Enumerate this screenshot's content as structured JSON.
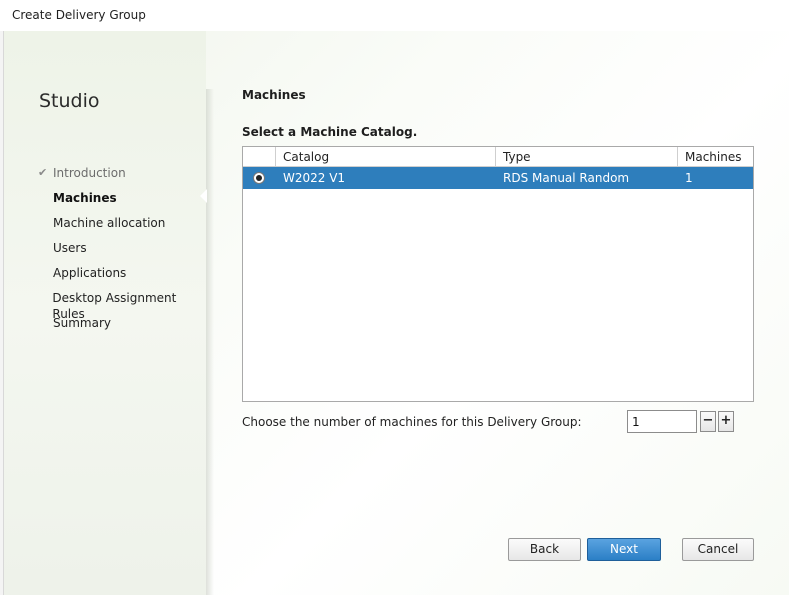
{
  "window": {
    "title": "Create Delivery Group"
  },
  "sidebar": {
    "title": "Studio",
    "steps": [
      {
        "label": "Introduction",
        "state": "done"
      },
      {
        "label": "Machines",
        "state": "active"
      },
      {
        "label": "Machine allocation",
        "state": "pending"
      },
      {
        "label": "Users",
        "state": "pending"
      },
      {
        "label": "Applications",
        "state": "pending"
      },
      {
        "label": "Desktop Assignment Rules",
        "state": "pending"
      },
      {
        "label": "Summary",
        "state": "pending"
      }
    ]
  },
  "main": {
    "title": "Machines",
    "catalog_prompt": "Select a Machine Catalog.",
    "table": {
      "columns": [
        "Catalog",
        "Type",
        "Machines"
      ],
      "rows": [
        {
          "catalog": "W2022 V1",
          "type": "RDS Manual Random",
          "machines": "1",
          "selected": true
        }
      ]
    },
    "count_label": "Choose the number of machines for this Delivery Group:",
    "count_value": "1",
    "minus_label": "−",
    "plus_label": "+"
  },
  "buttons": {
    "back": "Back",
    "next": "Next",
    "cancel": "Cancel"
  },
  "colors": {
    "selection": "#2e7ebc",
    "primary_button": "#2b7fc6"
  },
  "icons": {
    "done_step": "check-icon",
    "row_selector": "radio-icon"
  }
}
